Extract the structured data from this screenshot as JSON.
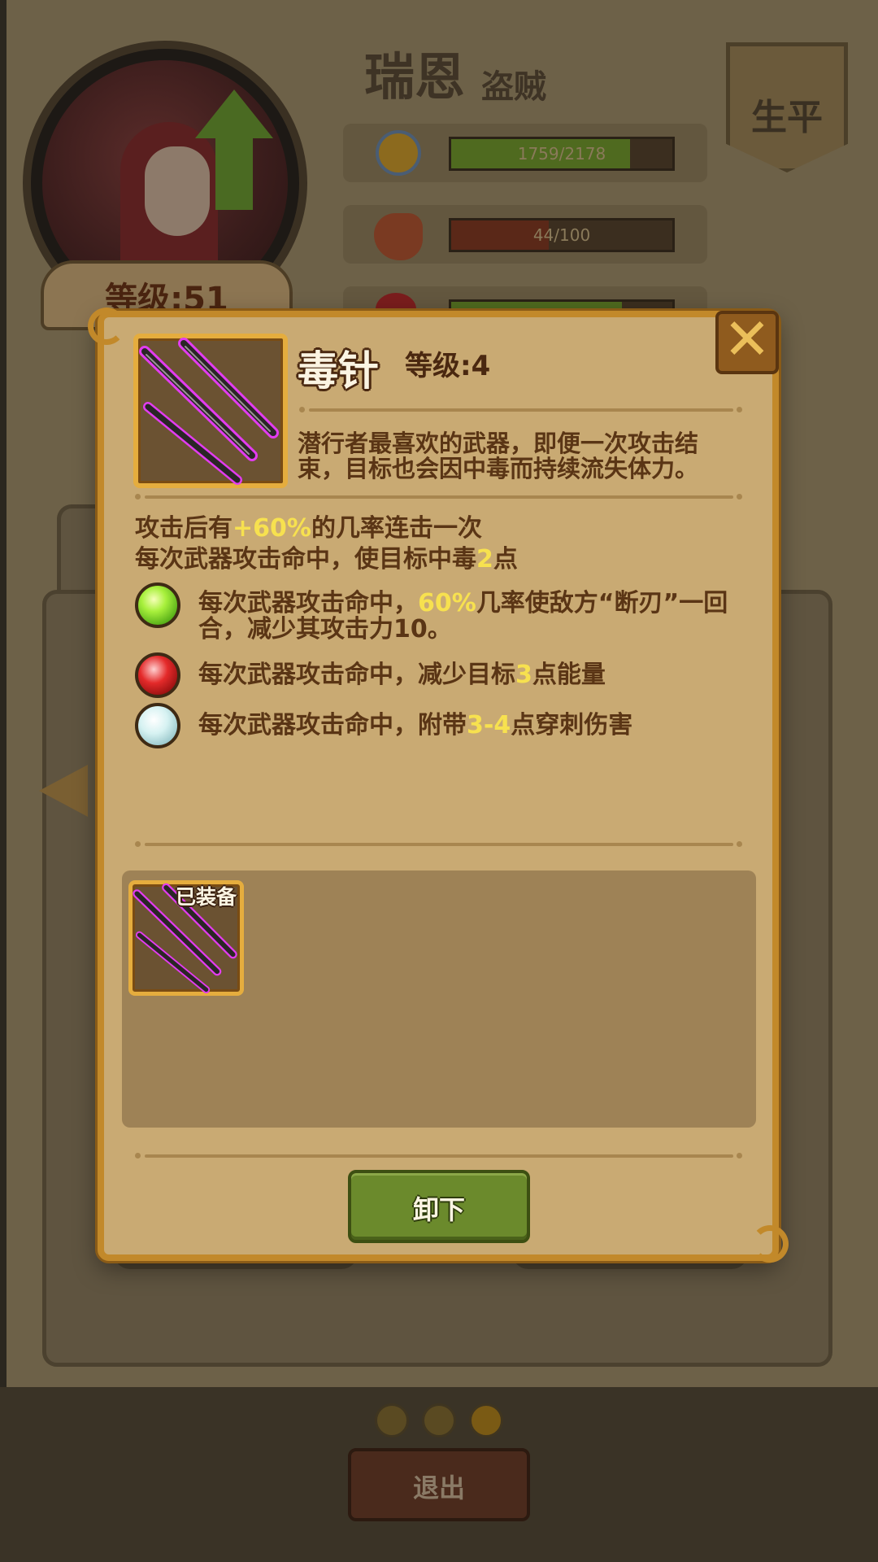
{
  "hero": {
    "name": "瑞恩",
    "class": "盗贼",
    "level_label": "等级:51",
    "bio_label": "生平"
  },
  "stats": {
    "experience": {
      "text": "1759/2178",
      "progress": 0.81,
      "icon": "medal-icon",
      "color": "#4f6a1f"
    },
    "hunger": {
      "text": "44/100",
      "progress": 0.44,
      "icon": "stomach-icon",
      "color": "#5a2818"
    },
    "health": {
      "icon": "heart-icon",
      "color": "#4f6a1f"
    }
  },
  "navigation": {
    "page_count": 3,
    "current_page": 3,
    "exit_label": "退出"
  },
  "modal": {
    "item_name": "毒针",
    "item_level": "等级:4",
    "item_icon": "poison-needle-icon",
    "description": "潜行者最喜欢的武器，即便一次攻击结束，目标也会因中毒而持续流失体力。",
    "effects": [
      {
        "prefix": "攻击后有",
        "highlight": "+60%",
        "suffix": "的几率连击一次"
      },
      {
        "prefix": "每次武器攻击命中，使目标中毒",
        "highlight": "2",
        "suffix": "点"
      }
    ],
    "gems": [
      {
        "gem": "green-gem-icon",
        "prefix": "每次武器攻击命中，",
        "highlight": "60%",
        "suffix": "几率使敌方“断刃”一回合，减少其攻击力10。"
      },
      {
        "gem": "red-gem-icon",
        "prefix": "每次武器攻击命中，减少目标",
        "highlight": "3",
        "suffix": "点能量"
      },
      {
        "gem": "white-gem-icon",
        "prefix": "每次武器攻击命中，附带",
        "highlight": "3-4",
        "suffix": "点穿刺伤害"
      }
    ],
    "equipped_tag": "已装备",
    "unequip_label": "卸下",
    "colors": {
      "highlight": "#f7e14f",
      "frame": "#e5ad3e",
      "button": "#6b8a2c",
      "needle_glow": "#e23cf0"
    }
  }
}
